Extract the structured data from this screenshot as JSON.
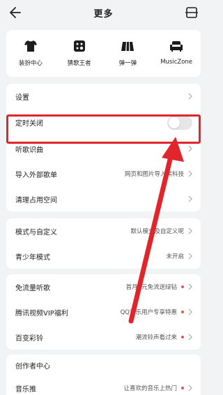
{
  "header": {
    "title": "更多"
  },
  "grid": [
    {
      "label": "装扮中心",
      "icon": "tshirt-icon"
    },
    {
      "label": "猜歌王者",
      "icon": "dice-icon"
    },
    {
      "label": "弹一弹",
      "icon": "piano-keys-icon"
    },
    {
      "label": "MusicZone",
      "icon": "sofa-icon"
    }
  ],
  "section1": {
    "settings": "设置",
    "timer_off": "定时关闭",
    "timer_off_enabled": false,
    "song_recognition": "听歌识曲",
    "import_playlist": "导入外部歌单",
    "import_playlist_sub": "网页和图片导入黑科技",
    "clear_space": "清理占用空间"
  },
  "section2": {
    "mode_custom": "模式与自定义",
    "mode_custom_sub": "默认模式及自定义呢",
    "teen_mode": "青少年模式",
    "teen_mode_sub": "未开启"
  },
  "section3": {
    "free_data": "免流量听歌",
    "free_data_sub": "首月0元免流送绿钻",
    "tencent_vip": "腾讯视频VIP福利",
    "tencent_vip_sub": "QQ音乐用户专享特惠",
    "ringtone": "百变彩铃",
    "ringtone_sub": "潮流铃声看过来"
  },
  "section4": {
    "creator_center": "创作者中心",
    "music_promo": "音乐推",
    "music_promo_sub": "让喜欢的音乐上热门"
  },
  "colors": {
    "highlight": "#e0262c",
    "dot": "#e8534f",
    "background": "#f2f3f5"
  }
}
